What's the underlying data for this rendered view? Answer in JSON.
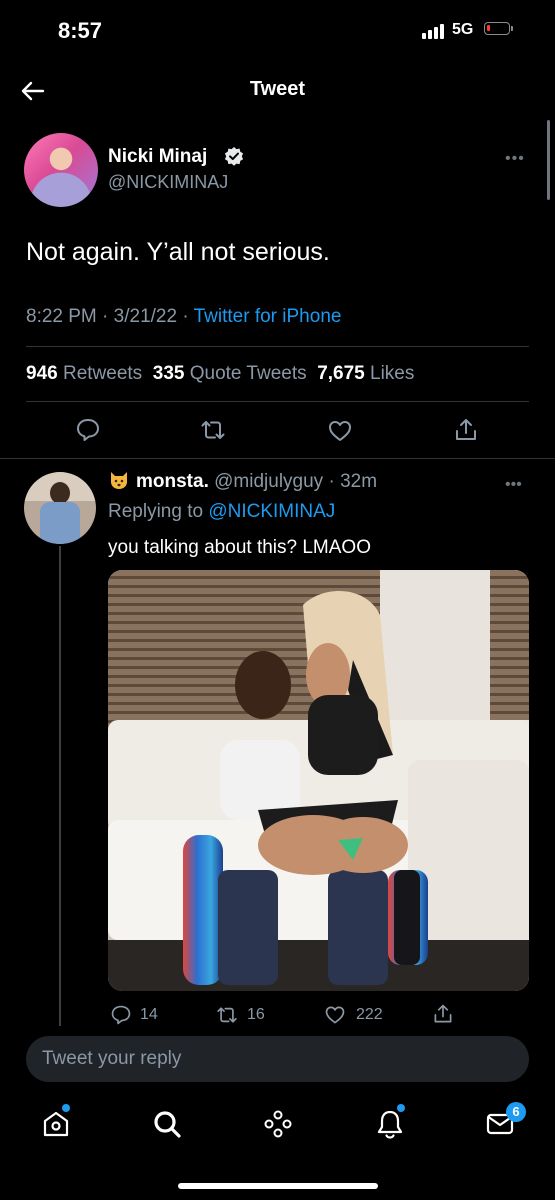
{
  "status_bar": {
    "time": "8:57",
    "network": "5G"
  },
  "header": {
    "title": "Tweet",
    "back_icon": "arrow-left-icon"
  },
  "tweet": {
    "author_name": "Nicki Minaj",
    "author_handle": "@NICKIMINAJ",
    "verified": true,
    "text": "Not again. Y’all not serious.",
    "time": "8:22 PM",
    "date": "3/21/22",
    "source": "Twitter for iPhone",
    "retweets_count": "946",
    "retweets_label": "Retweets",
    "quotes_count": "335",
    "quotes_label": "Quote Tweets",
    "likes_count": "7,675",
    "likes_label": "Likes"
  },
  "reply": {
    "author_name": "monsta.",
    "author_handle": "@midjulyguy",
    "age": "32m",
    "replying_prefix": "Replying to",
    "replying_handle": "@NICKIMINAJ",
    "text": "you talking about this? LMAOO",
    "reply_count": "14",
    "retweet_count": "16",
    "like_count": "222"
  },
  "composer": {
    "placeholder": "Tweet your reply"
  },
  "bottom_nav": {
    "items": [
      "home-icon",
      "search-icon",
      "spaces-icon",
      "notifications-icon",
      "messages-icon"
    ],
    "messages_badge": "6"
  },
  "colors": {
    "accent": "#1d9bf0",
    "background": "#000000",
    "secondary_text": "#8b98a5"
  }
}
